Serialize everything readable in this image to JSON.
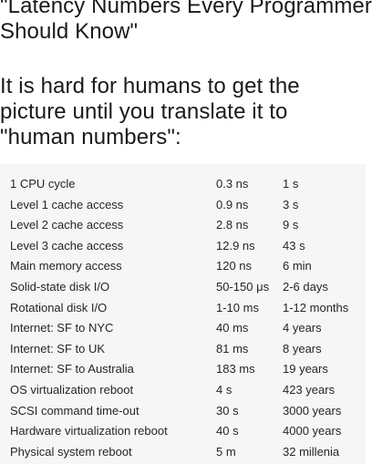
{
  "heading": {
    "title": "\"Latency Numbers Every Programmer\nShould Know\"",
    "subtitle": "It is hard for humans to get the\npicture until you translate it to\n\"human numbers\":"
  },
  "table": {
    "rows": [
      {
        "name": "1 CPU cycle",
        "actual": "0.3 ns",
        "human": "1 s"
      },
      {
        "name": "Level 1 cache access",
        "actual": "0.9 ns",
        "human": "3 s"
      },
      {
        "name": "Level 2 cache access",
        "actual": "2.8 ns",
        "human": "9 s"
      },
      {
        "name": "Level 3 cache access",
        "actual": "12.9 ns",
        "human": "43 s"
      },
      {
        "name": "Main memory access",
        "actual": "120 ns",
        "human": "6 min"
      },
      {
        "name": "Solid-state disk I/O",
        "actual": "50-150 μs",
        "human": "2-6 days"
      },
      {
        "name": "Rotational disk I/O",
        "actual": "1-10 ms",
        "human": "1-12 months"
      },
      {
        "name": "Internet: SF to NYC",
        "actual": "40 ms",
        "human": "4 years"
      },
      {
        "name": "Internet: SF to UK",
        "actual": "81 ms",
        "human": "8 years"
      },
      {
        "name": "Internet: SF to Australia",
        "actual": "183 ms",
        "human": "19 years"
      },
      {
        "name": "OS virtualization reboot",
        "actual": "4 s",
        "human": "423 years"
      },
      {
        "name": "SCSI command time-out",
        "actual": "30 s",
        "human": "3000 years"
      },
      {
        "name": "Hardware virtualization reboot",
        "actual": "40 s",
        "human": "4000 years"
      },
      {
        "name": "Physical system reboot",
        "actual": "5 m",
        "human": "32 millenia"
      }
    ]
  }
}
